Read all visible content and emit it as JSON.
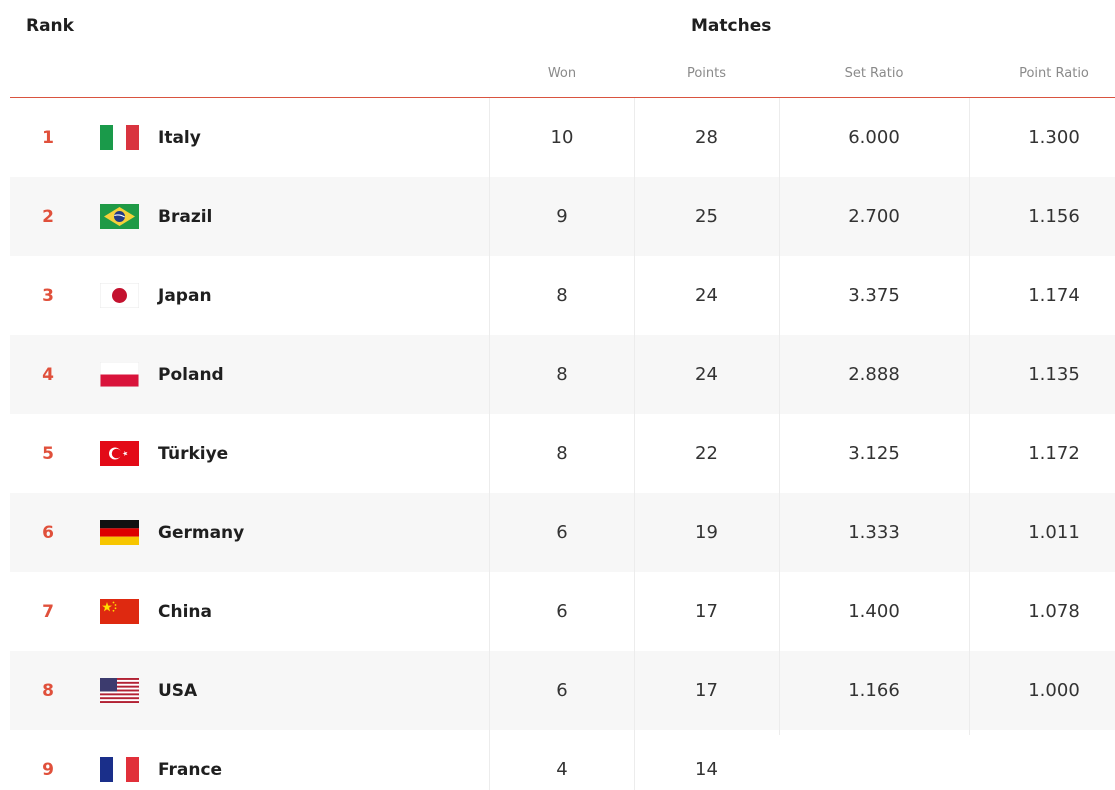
{
  "header": {
    "rank": "Rank",
    "matches": "Matches",
    "columns": {
      "won": "Won",
      "points": "Points",
      "set_ratio": "Set Ratio",
      "point_ratio": "Point Ratio"
    }
  },
  "accent_color": "#e0503b",
  "rows": [
    {
      "rank": "1",
      "country": "Italy",
      "flag": "flag-italy",
      "won": "10",
      "points": "28",
      "set_ratio": "6.000",
      "point_ratio": "1.300"
    },
    {
      "rank": "2",
      "country": "Brazil",
      "flag": "flag-brazil",
      "won": "9",
      "points": "25",
      "set_ratio": "2.700",
      "point_ratio": "1.156"
    },
    {
      "rank": "3",
      "country": "Japan",
      "flag": "flag-japan",
      "won": "8",
      "points": "24",
      "set_ratio": "3.375",
      "point_ratio": "1.174"
    },
    {
      "rank": "4",
      "country": "Poland",
      "flag": "flag-poland",
      "won": "8",
      "points": "24",
      "set_ratio": "2.888",
      "point_ratio": "1.135"
    },
    {
      "rank": "5",
      "country": "Türkiye",
      "flag": "flag-turkiye",
      "won": "8",
      "points": "22",
      "set_ratio": "3.125",
      "point_ratio": "1.172"
    },
    {
      "rank": "6",
      "country": "Germany",
      "flag": "flag-germany",
      "won": "6",
      "points": "19",
      "set_ratio": "1.333",
      "point_ratio": "1.011"
    },
    {
      "rank": "7",
      "country": "China",
      "flag": "flag-china",
      "won": "6",
      "points": "17",
      "set_ratio": "1.400",
      "point_ratio": "1.078"
    },
    {
      "rank": "8",
      "country": "USA",
      "flag": "flag-usa",
      "won": "6",
      "points": "17",
      "set_ratio": "1.166",
      "point_ratio": "1.000"
    },
    {
      "rank": "9",
      "country": "France",
      "flag": "flag-france",
      "won": "4",
      "points": "14",
      "set_ratio": "",
      "point_ratio": ""
    }
  ]
}
